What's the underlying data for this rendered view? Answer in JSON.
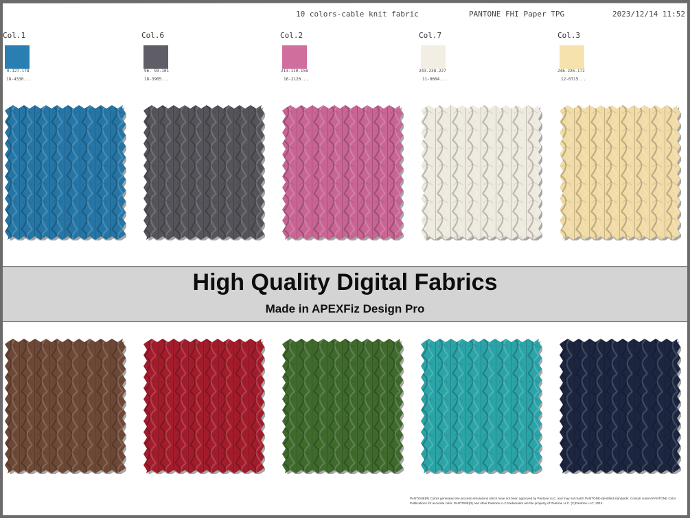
{
  "header": {
    "title": "10 colors-cable knit fabric",
    "library": "PANTONE FHI Paper TPG",
    "datetime": "2023/12/14 11:52"
  },
  "colors": [
    {
      "name": "Col.1",
      "rgb": "0.127.178",
      "code": "18-4330...",
      "hex": "#2a7fb2"
    },
    {
      "name": "Col.6",
      "rgb": "96. 93.101",
      "code": "18-3905...",
      "hex": "#5f5d65"
    },
    {
      "name": "Col.2",
      "rgb": "213.110.158",
      "code": "16-2120...",
      "hex": "#d06e9e"
    },
    {
      "name": "Col.7",
      "rgb": "243.238.227",
      "code": "11-0604...",
      "hex": "#f3eee3"
    },
    {
      "name": "Col.3",
      "rgb": "246.226.172",
      "code": "12-0715...",
      "hex": "#f6e2ac"
    }
  ],
  "fabrics_top": [
    {
      "color": "#2576a6"
    },
    {
      "color": "#55545a"
    },
    {
      "color": "#c96595"
    },
    {
      "color": "#eeeadf"
    },
    {
      "color": "#f1dba6"
    }
  ],
  "fabrics_bottom": [
    {
      "color": "#6e4836"
    },
    {
      "color": "#a31c2c"
    },
    {
      "color": "#3f6a2c"
    },
    {
      "color": "#2aa4a8"
    },
    {
      "color": "#1c2640"
    }
  ],
  "banner": {
    "title": "High Quality Digital Fabrics",
    "subtitle": "Made in APEXFiz Design Pro"
  },
  "disclaimer": "PANTONE(R) Colors generated are process simulations which have not been approved by Pantone LLC, and may not match PANTONE-identified standards. Consult current PANTONE Color Publications for accurate color. PANTONE(R) and other Pantone LLC trademarks are the property of Pantone LLC. (C)Pantone LLC, 2014."
}
